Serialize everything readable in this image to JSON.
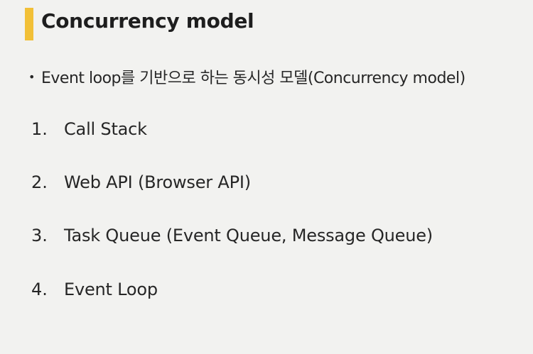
{
  "slide": {
    "title": "Concurrency model",
    "accent_color": "#f2c037",
    "bullet": {
      "marker": "•",
      "text": "Event loop를 기반으로 하는 동시성 모델(Concurrency model)"
    },
    "items": [
      {
        "number": "1.",
        "text": "Call Stack"
      },
      {
        "number": "2.",
        "text": "Web API (Browser API)"
      },
      {
        "number": "3.",
        "text": "Task Queue (Event Queue, Message Queue)"
      },
      {
        "number": "4.",
        "text": "Event Loop"
      }
    ]
  }
}
